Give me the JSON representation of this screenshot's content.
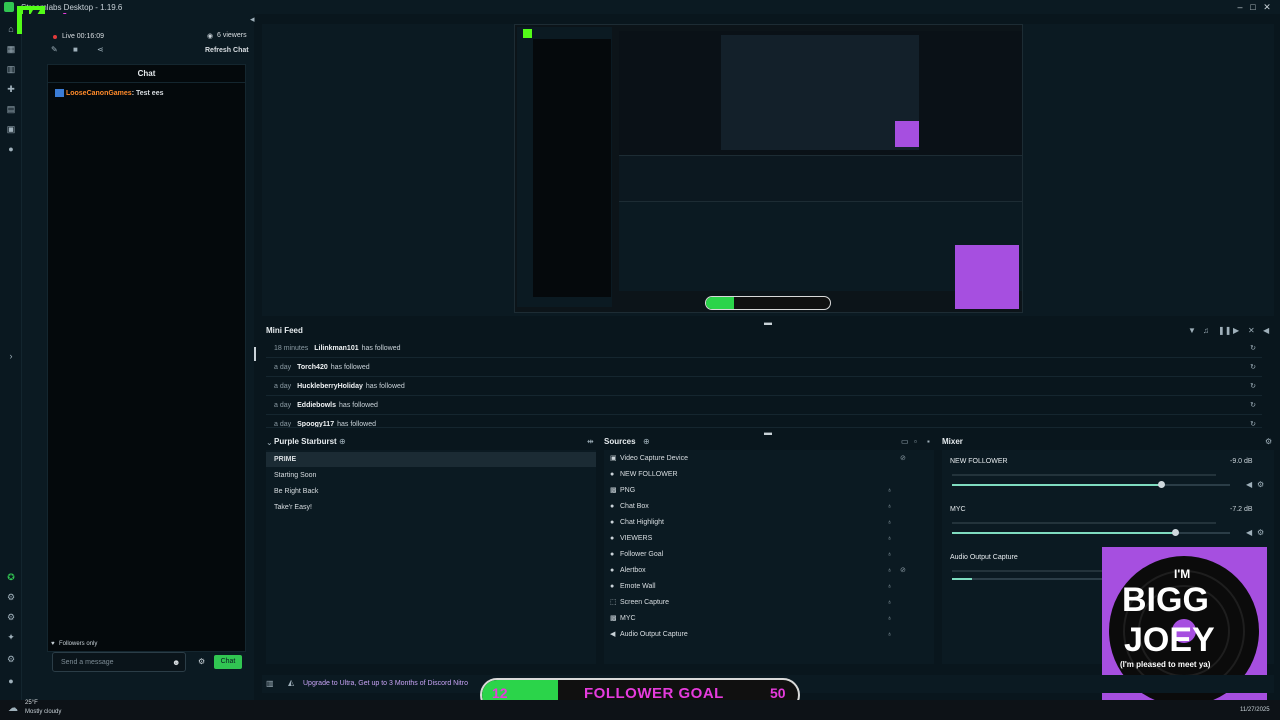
{
  "app": {
    "title": "Streamlabs Desktop - 1.19.6"
  },
  "colors": {
    "accent": "#31c652",
    "brand_purple": "#a64fe0",
    "goal_text": "#e63bdc",
    "username_orange": "#ff8a2a"
  },
  "stream": {
    "live_label": "Live 00:16:09",
    "viewers": "6 viewers",
    "refresh_chat": "Refresh Chat"
  },
  "chat": {
    "header": "Chat",
    "message_user": "LooseCanonGames",
    "message_text": ": Test ees",
    "followers_only": "Followers only",
    "input_placeholder": "Send a message",
    "send_label": "Chat"
  },
  "minifeed": {
    "title": "Mini Feed",
    "items": [
      {
        "time": "18 minutes",
        "user": "Lilinkman101",
        "action": "has followed"
      },
      {
        "time": "a day",
        "user": "Torch420",
        "action": "has followed"
      },
      {
        "time": "a day",
        "user": "HuckleberryHoliday",
        "action": "has followed"
      },
      {
        "time": "a day",
        "user": "Eddiebowls",
        "action": "has followed"
      },
      {
        "time": "a day",
        "user": "Spoogy117",
        "action": "has followed"
      }
    ]
  },
  "scenes": {
    "title": "Purple Starburst",
    "items": [
      "PRIME",
      "Starting Soon",
      "Be Right Back",
      "Take'r Easy!"
    ]
  },
  "sources": {
    "title": "Sources",
    "items": [
      {
        "label": "Video Capture Device",
        "icon": "camera-icon"
      },
      {
        "label": "NEW FOLLOWER",
        "icon": "widget-icon"
      },
      {
        "label": "PNG",
        "icon": "image-icon"
      },
      {
        "label": "Chat Box",
        "icon": "chat-icon"
      },
      {
        "label": "Chat Highlight",
        "icon": "chat-icon"
      },
      {
        "label": "VIEWERS",
        "icon": "widget-icon"
      },
      {
        "label": "Follower Goal",
        "icon": "goal-icon"
      },
      {
        "label": "Alertbox",
        "icon": "bell-icon"
      },
      {
        "label": "Emote Wall",
        "icon": "widget-icon"
      },
      {
        "label": "Screen Capture",
        "icon": "screen-icon"
      },
      {
        "label": "MYC",
        "icon": "image-icon"
      },
      {
        "label": "Audio Output Capture",
        "icon": "speaker-icon"
      }
    ]
  },
  "mixer": {
    "title": "Mixer",
    "channels": [
      {
        "name": "NEW FOLLOWER",
        "db": "-9.0 dB",
        "level": 0.75
      },
      {
        "name": "MYC",
        "db": "-7.2 dB",
        "level": 0.81
      },
      {
        "name": "Audio Output Capture",
        "db": "",
        "level": 0.07
      }
    ]
  },
  "statusbar": {
    "promo": "Upgrade to Ultra, Get up to 3 Months of Discord Nitro"
  },
  "goal": {
    "current": "12",
    "title": "FOLLOWER GOAL",
    "target": "50",
    "progress": 0.24
  },
  "badge": {
    "line1": "I'M",
    "line2": "BIGG",
    "line3": "JOEY",
    "tagline": "(I'm pleased to meet ya)"
  },
  "taskbar": {
    "temp": "25°F",
    "weather": "Mostly cloudy",
    "date": "11/27/2025"
  }
}
